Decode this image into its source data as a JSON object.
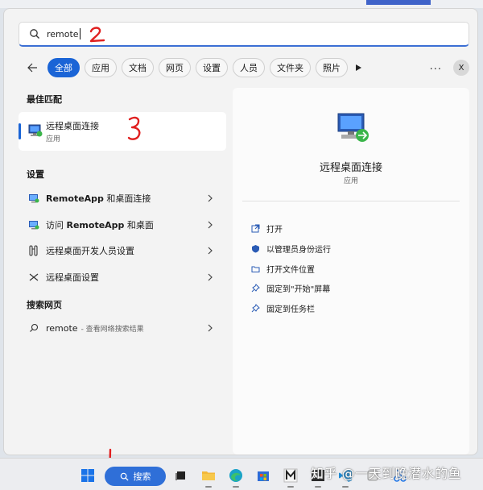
{
  "search": {
    "query": "remote"
  },
  "filters": [
    {
      "label": "全部",
      "active": true
    },
    {
      "label": "应用",
      "active": false
    },
    {
      "label": "文档",
      "active": false
    },
    {
      "label": "网页",
      "active": false
    },
    {
      "label": "设置",
      "active": false
    },
    {
      "label": "人员",
      "active": false
    },
    {
      "label": "文件夹",
      "active": false
    },
    {
      "label": "照片",
      "active": false
    }
  ],
  "filter_more": "...",
  "filter_close": "X",
  "left": {
    "best_match_title": "最佳匹配",
    "best_match": {
      "name": "远程桌面连接",
      "type": "应用"
    },
    "settings_title": "设置",
    "settings": [
      {
        "bold": "RemoteApp",
        "rest": " 和桌面连接"
      },
      {
        "pre": "访问 ",
        "bold": "RemoteApp",
        "rest": " 和桌面"
      },
      {
        "rest": "远程桌面开发人员设置"
      },
      {
        "rest": "远程桌面设置"
      }
    ],
    "web_title": "搜索网页",
    "web": {
      "query": "remote",
      "sub": "- 查看网络搜索结果"
    }
  },
  "right": {
    "name": "远程桌面连接",
    "type": "应用",
    "actions": [
      {
        "label": "打开",
        "icon": "open-icon"
      },
      {
        "label": "以管理员身份运行",
        "icon": "shield-icon"
      },
      {
        "label": "打开文件位置",
        "icon": "folder-icon"
      },
      {
        "label": "固定到\"开始\"屏幕",
        "icon": "pin-icon"
      },
      {
        "label": "固定到任务栏",
        "icon": "pin-icon"
      }
    ]
  },
  "taskbar": {
    "search_label": "搜索"
  },
  "watermark": "知乎 @一天到晚潜水的鱼",
  "colors": {
    "accent": "#1a64d6",
    "annotation": "#e02020"
  }
}
